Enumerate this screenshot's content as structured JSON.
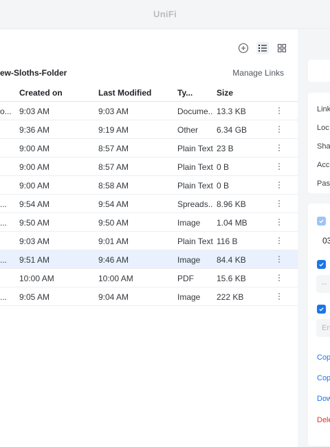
{
  "app": {
    "title": "UniFi"
  },
  "toolbar": {
    "add_icon": "plus-circle-icon",
    "list_icon": "list-view-icon",
    "grid_icon": "grid-view-icon"
  },
  "folder": {
    "name": "ew-Sloths-Folder",
    "manage_links": "Manage Links"
  },
  "table": {
    "columns": {
      "created": "Created on",
      "modified": "Last Modified",
      "type": "Ty...",
      "size": "Size"
    },
    "rows": [
      {
        "name": "o...",
        "created": "9:03 AM",
        "modified": "9:03 AM",
        "type": "Docume...",
        "size": "13.3 KB"
      },
      {
        "name": "",
        "created": "9:36 AM",
        "modified": "9:19 AM",
        "type": "Other",
        "size": "6.34 GB"
      },
      {
        "name": "",
        "created": "9:00 AM",
        "modified": "8:57 AM",
        "type": "Plain Text",
        "size": "23 B"
      },
      {
        "name": "",
        "created": "9:00 AM",
        "modified": "8:57 AM",
        "type": "Plain Text",
        "size": "0 B"
      },
      {
        "name": "",
        "created": "9:00 AM",
        "modified": "8:58 AM",
        "type": "Plain Text",
        "size": "0 B"
      },
      {
        "name": "...",
        "created": "9:54 AM",
        "modified": "9:54 AM",
        "type": "Spreads...",
        "size": "8.96 KB"
      },
      {
        "name": "...",
        "created": "9:50 AM",
        "modified": "9:50 AM",
        "type": "Image",
        "size": "1.04 MB"
      },
      {
        "name": "",
        "created": "9:03 AM",
        "modified": "9:01 AM",
        "type": "Plain Text",
        "size": "116 B"
      },
      {
        "name": "...",
        "created": "9:51 AM",
        "modified": "9:46 AM",
        "type": "Image",
        "size": "84.4 KB"
      },
      {
        "name": "",
        "created": "10:00 AM",
        "modified": "10:00 AM",
        "type": "PDF",
        "size": "15.6 KB"
      },
      {
        "name": "...",
        "created": "9:05 AM",
        "modified": "9:04 AM",
        "type": "Image",
        "size": "222 KB"
      }
    ]
  },
  "side_panel": {
    "info_labels": [
      "Link",
      "Loc",
      "Sha",
      "Acc",
      "Pass"
    ],
    "date_value": "03",
    "password_placeholder": "Ent",
    "other_placeholder": "--",
    "actions": {
      "copy1": "Cop",
      "copy2": "Cop",
      "download": "Dow",
      "delete": "Dele"
    }
  },
  "colors": {
    "accent": "#1a76e8",
    "danger": "#e0312b",
    "selected_row": "#e8f1fd"
  }
}
